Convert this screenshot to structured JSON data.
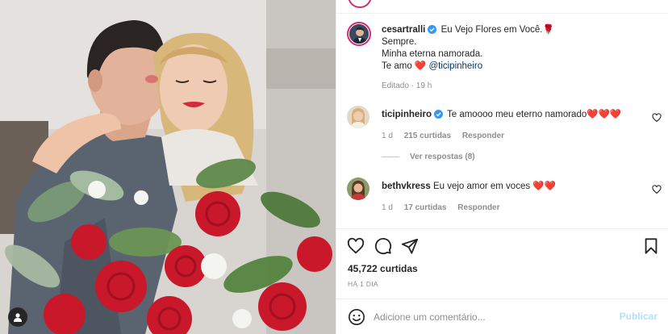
{
  "post": {
    "author": "cesartralli",
    "caption_line1": "Eu Vejo Flores em Você.",
    "caption_emoji": "🌹",
    "caption_line2": "Sempre.",
    "caption_line3": "Minha eterna namorada.",
    "caption_line4_prefix": "Te amo",
    "caption_heart": "❤️",
    "caption_mention": "@ticipinheiro",
    "edited_meta": "Editado · 19 h",
    "likes": "45,722 curtidas",
    "time_ago": "HÁ 1 DIA"
  },
  "comments": [
    {
      "user": "ticipinheiro",
      "verified": true,
      "text": "Te amoooo meu eterno namorado❤️❤️❤️",
      "age": "1 d",
      "likes": "215 curtidas",
      "reply": "Responder"
    },
    {
      "user": "bethvkress",
      "verified": false,
      "text": "Eu vejo amor em voces ❤️❤️",
      "age": "1 d",
      "likes": "17 curtidas",
      "reply": "Responder"
    }
  ],
  "view_replies": "Ver respostas (8)",
  "add_comment": {
    "placeholder": "Adicione um comentário...",
    "publish_label": "Publicar"
  },
  "colors": {
    "verified": "#3897f0",
    "link": "#00376b",
    "muted": "#8e8e8e",
    "publish_disabled": "#b2dffc",
    "story_ring": "#d62976"
  },
  "icons": [
    "user-icon",
    "verified-icon",
    "heart-icon",
    "comment-icon",
    "share-icon",
    "bookmark-icon",
    "emoji-icon"
  ]
}
